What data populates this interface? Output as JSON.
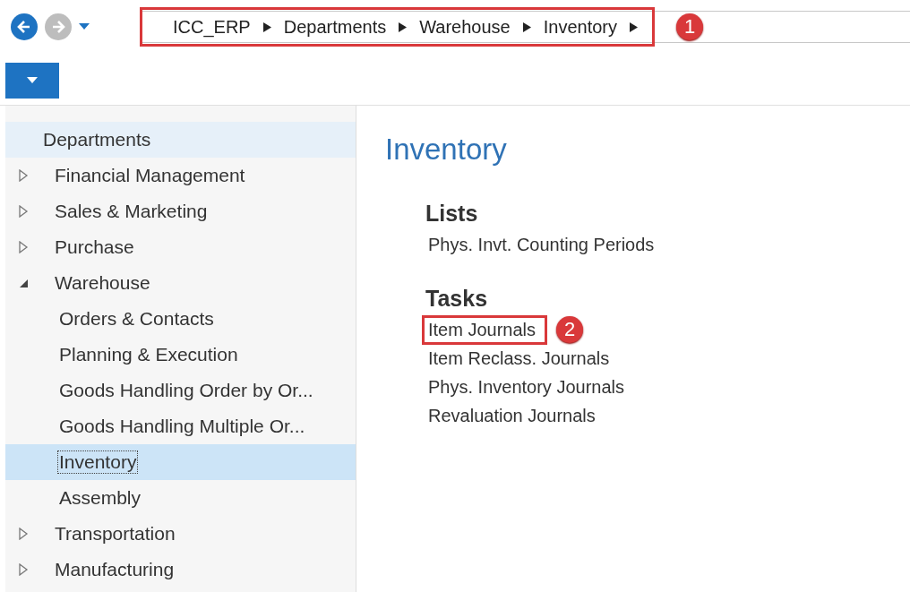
{
  "navigation": {
    "breadcrumb": [
      "ICC_ERP",
      "Departments",
      "Warehouse",
      "Inventory"
    ],
    "breadcrumb_annotation": "1"
  },
  "sidebar": {
    "root": "Departments",
    "items": [
      {
        "label": "Financial Management",
        "expanded": false,
        "selected": false
      },
      {
        "label": "Sales & Marketing",
        "expanded": false,
        "selected": false
      },
      {
        "label": "Purchase",
        "expanded": false,
        "selected": false
      },
      {
        "label": "Warehouse",
        "expanded": true,
        "selected": false,
        "children": [
          {
            "label": "Orders & Contacts",
            "selected": false
          },
          {
            "label": "Planning & Execution",
            "selected": false
          },
          {
            "label": "Goods Handling Order by Or...",
            "selected": false
          },
          {
            "label": "Goods Handling Multiple Or...",
            "selected": false
          },
          {
            "label": "Inventory",
            "selected": true
          },
          {
            "label": "Assembly",
            "selected": false
          }
        ]
      },
      {
        "label": "Transportation",
        "expanded": false,
        "selected": false
      },
      {
        "label": "Manufacturing",
        "expanded": false,
        "selected": false
      }
    ]
  },
  "content": {
    "title": "Inventory",
    "sections": [
      {
        "heading": "Lists",
        "links": [
          {
            "label": "Phys. Invt. Counting Periods",
            "highlighted": false
          }
        ]
      },
      {
        "heading": "Tasks",
        "links": [
          {
            "label": "Item Journals",
            "highlighted": true,
            "annotation": "2"
          },
          {
            "label": "Item Reclass. Journals",
            "highlighted": false
          },
          {
            "label": "Phys. Inventory Journals",
            "highlighted": false
          },
          {
            "label": "Revaluation Journals",
            "highlighted": false
          }
        ]
      }
    ]
  }
}
